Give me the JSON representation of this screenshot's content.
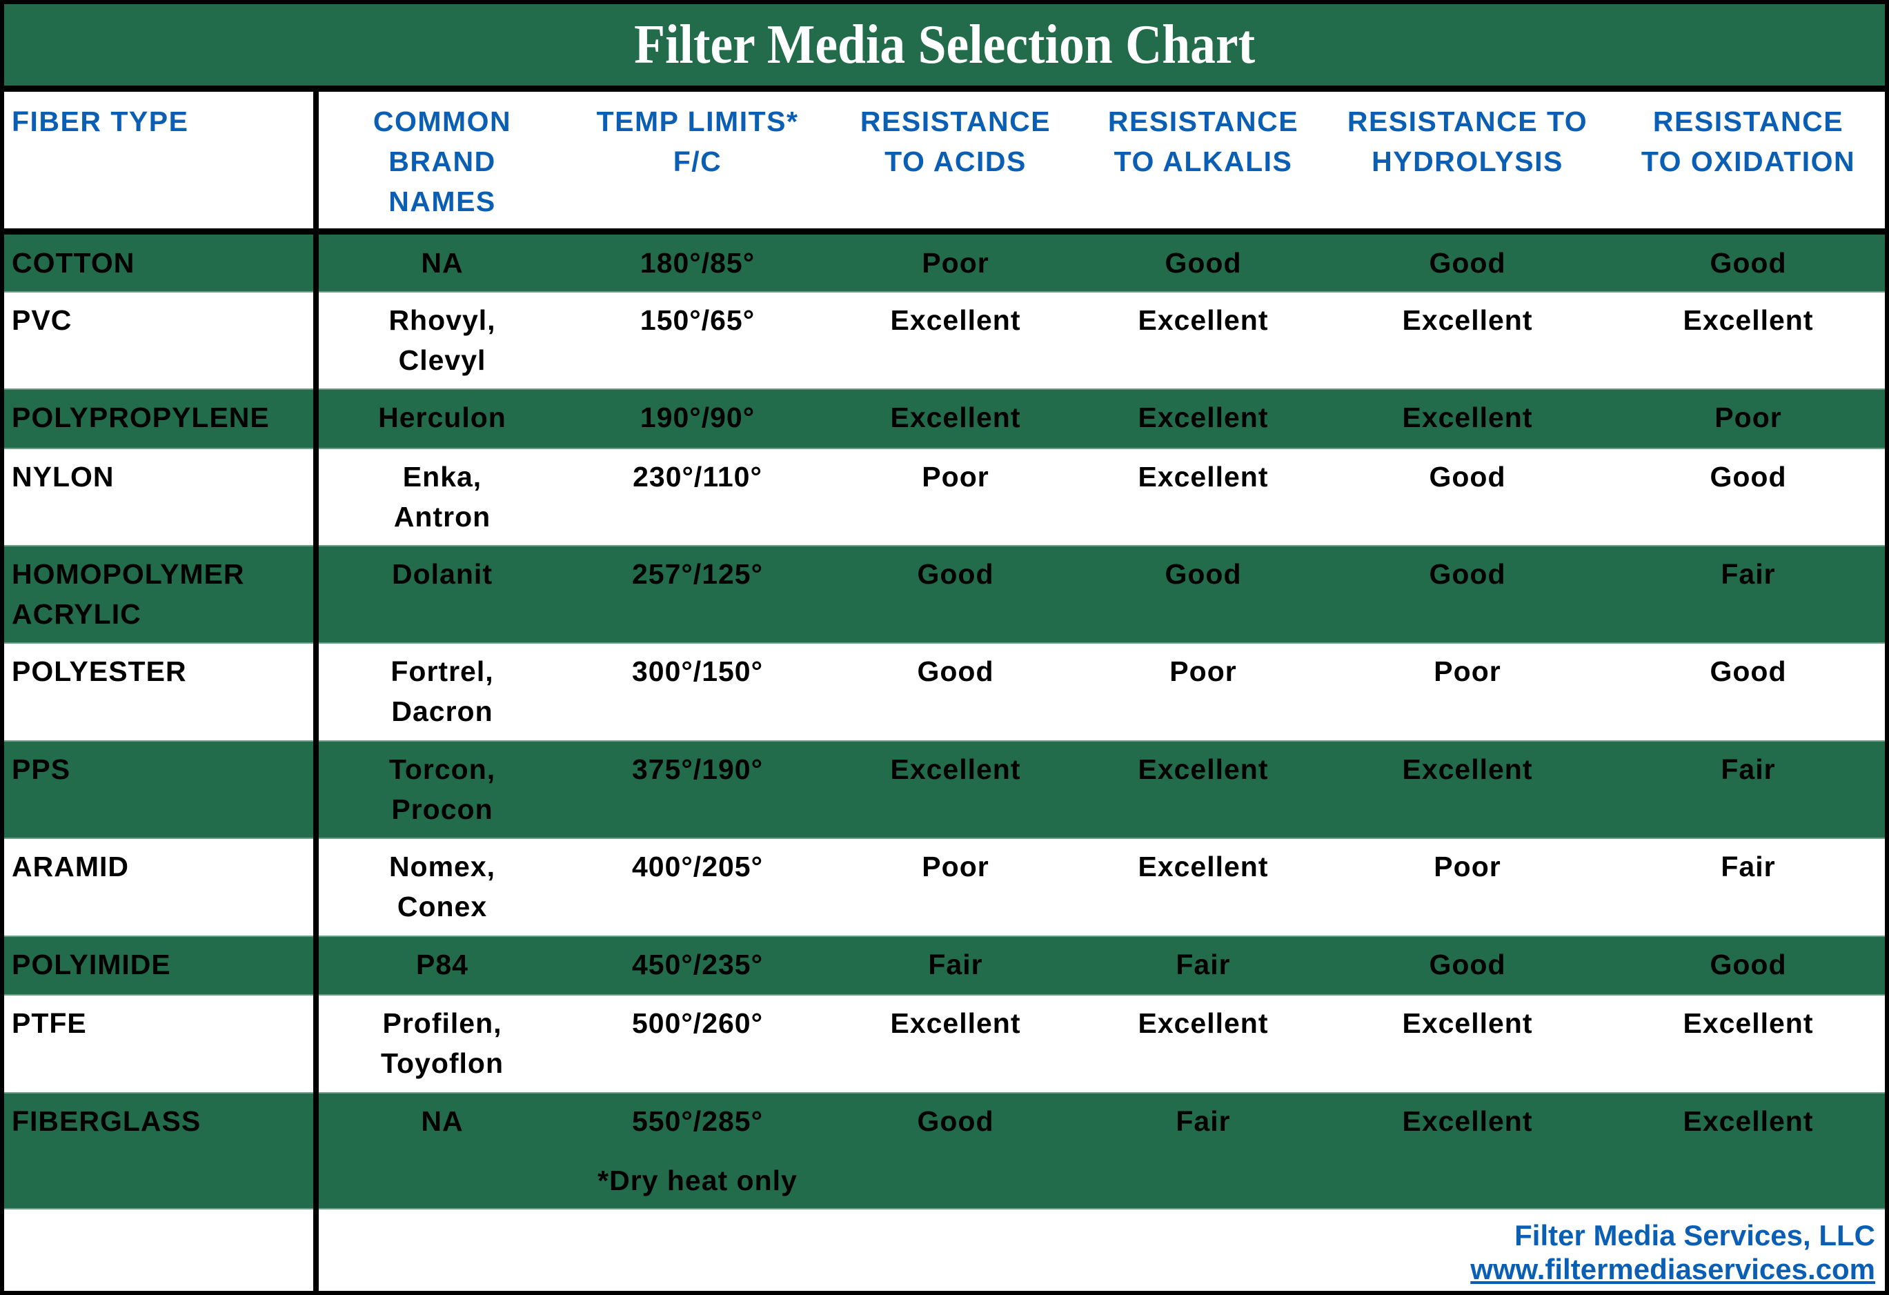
{
  "title": "Filter Media Selection Chart",
  "columns": [
    "FIBER TYPE",
    "COMMON\nBRAND\nNAMES",
    "TEMP LIMITS*\nF/C",
    "RESISTANCE\nTO ACIDS",
    "RESISTANCE\nTO ALKALIS",
    "RESISTANCE TO\nHYDROLYSIS",
    "RESISTANCE\nTO OXIDATION"
  ],
  "rows": [
    {
      "fiber": "COTTON",
      "brands": "NA",
      "temp": "180°/85°",
      "acids": "Poor",
      "alkalis": "Good",
      "hydrolysis": "Good",
      "oxidation": "Good"
    },
    {
      "fiber": "PVC",
      "brands": "Rhovyl,\nClevyl",
      "temp": "150°/65°",
      "acids": "Excellent",
      "alkalis": "Excellent",
      "hydrolysis": "Excellent",
      "oxidation": "Excellent"
    },
    {
      "fiber": "POLYPROPYLENE",
      "brands": "Herculon",
      "temp": "190°/90°",
      "acids": "Excellent",
      "alkalis": "Excellent",
      "hydrolysis": "Excellent",
      "oxidation": "Poor"
    },
    {
      "fiber": "NYLON",
      "brands": "Enka,\nAntron",
      "temp": "230°/110°",
      "acids": "Poor",
      "alkalis": "Excellent",
      "hydrolysis": "Good",
      "oxidation": "Good"
    },
    {
      "fiber": "HOMOPOLYMER\nACRYLIC",
      "brands": "Dolanit",
      "temp": "257°/125°",
      "acids": "Good",
      "alkalis": "Good",
      "hydrolysis": "Good",
      "oxidation": "Fair"
    },
    {
      "fiber": "POLYESTER",
      "brands": "Fortrel,\nDacron",
      "temp": "300°/150°",
      "acids": "Good",
      "alkalis": "Poor",
      "hydrolysis": "Poor",
      "oxidation": "Good"
    },
    {
      "fiber": "PPS",
      "brands": "Torcon,\nProcon",
      "temp": "375°/190°",
      "acids": "Excellent",
      "alkalis": "Excellent",
      "hydrolysis": "Excellent",
      "oxidation": "Fair"
    },
    {
      "fiber": "ARAMID",
      "brands": "Nomex,\nConex",
      "temp": "400°/205°",
      "acids": "Poor",
      "alkalis": "Excellent",
      "hydrolysis": "Poor",
      "oxidation": "Fair"
    },
    {
      "fiber": "POLYIMIDE",
      "brands": "P84",
      "temp": "450°/235°",
      "acids": "Fair",
      "alkalis": "Fair",
      "hydrolysis": "Good",
      "oxidation": "Good"
    },
    {
      "fiber": "PTFE",
      "brands": "Profilen,\nToyoflon",
      "temp": "500°/260°",
      "acids": "Excellent",
      "alkalis": "Excellent",
      "hydrolysis": "Excellent",
      "oxidation": "Excellent"
    },
    {
      "fiber": "FIBERGLASS",
      "brands": "NA",
      "temp": "550°/285°",
      "acids": "Good",
      "alkalis": "Fair",
      "hydrolysis": "Excellent",
      "oxidation": "Excellent"
    }
  ],
  "footnote": "*Dry heat only",
  "footer": {
    "company": "Filter Media Services, LLC",
    "url": "www.filtermediaservices.com"
  },
  "colors": {
    "band_green": "#226b4b",
    "header_blue": "#0a5fb4"
  }
}
